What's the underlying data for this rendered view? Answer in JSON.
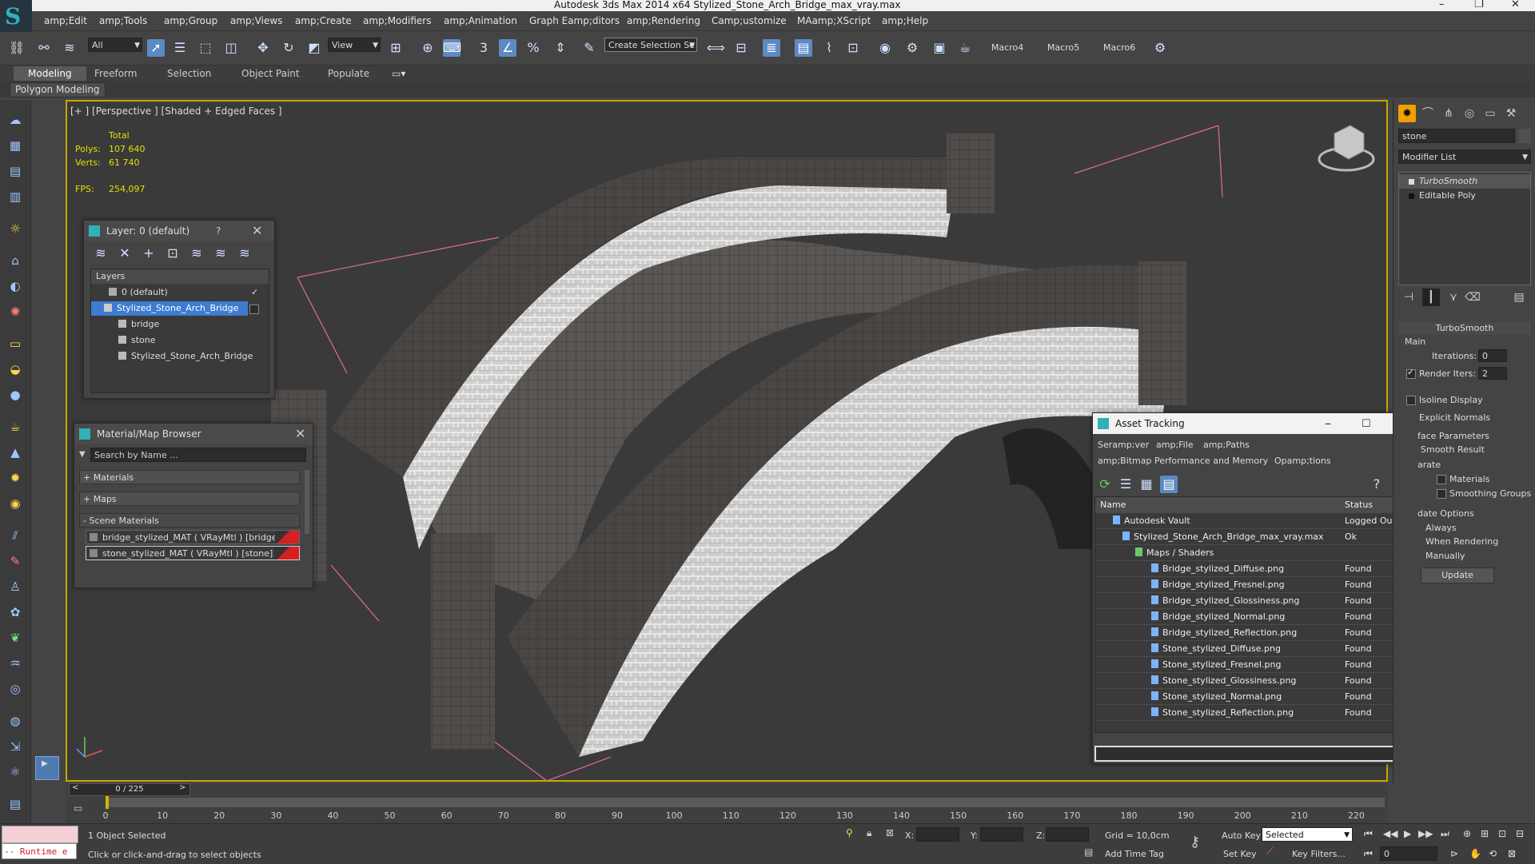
{
  "window": {
    "title": "Autodesk 3ds Max  2014 x64     Stylized_Stone_Arch_Bridge_max_vray.max",
    "min": "–",
    "max": "❐",
    "close": "✕"
  },
  "menu": [
    "amp;Edit",
    "amp;Tools",
    "amp;Group",
    "amp;Views",
    "amp;Create",
    "amp;Modifiers",
    "amp;Animation",
    "Graph Eamp;ditors",
    "amp;Rendering",
    "Camp;ustomize",
    "MAamp;XScript",
    "amp;Help"
  ],
  "toolbar": {
    "filter": "All",
    "refcoord": "View",
    "snap3": "3",
    "selection_set": "Create Selection Se",
    "macros": [
      "Macro4",
      "Macro5",
      "Macro6"
    ]
  },
  "ribbon": {
    "tabs": [
      "Modeling",
      "Freeform",
      "Selection",
      "Object Paint",
      "Populate"
    ],
    "active": "Modeling",
    "sub": "Polygon Modeling"
  },
  "viewport": {
    "label": "[+ ] [Perspective ] [Shaded + Edged Faces ]",
    "stats": {
      "total": "Total",
      "polys_label": "Polys:",
      "polys": "107 640",
      "verts_label": "Verts:",
      "verts": "61 740",
      "fps_label": "FPS:",
      "fps": "254,097"
    }
  },
  "layer_panel": {
    "title": "Layer: 0 (default)",
    "help": "?",
    "header": "Layers",
    "rows": [
      "0 (default)",
      "Stylized_Stone_Arch_Bridge",
      "bridge",
      "stone",
      "Stylized_Stone_Arch_Bridge"
    ]
  },
  "material_browser": {
    "title": "Material/Map Browser",
    "search": "Search by Name ...",
    "sections": [
      "+ Materials",
      "+ Maps",
      "- Scene Materials"
    ],
    "materials": [
      "bridge_stylized_MAT ( VRayMtl ) [bridge]",
      "stone_stylized_MAT ( VRayMtl ) [stone]"
    ]
  },
  "asset_tracking": {
    "title": "Asset Tracking",
    "menu1": [
      "Seramp;ver",
      "amp;File",
      "amp;Paths"
    ],
    "menu2": [
      "amp;Bitmap Performance and Memory",
      "Opamp;tions"
    ],
    "col_name": "Name",
    "col_status": "Status",
    "rows": [
      {
        "name": "Autodesk Vault",
        "status": "Logged Out ..."
      },
      {
        "name": "Stylized_Stone_Arch_Bridge_max_vray.max",
        "status": "Ok"
      },
      {
        "name": "Maps / Shaders",
        "status": ""
      },
      {
        "name": "Bridge_stylized_Diffuse.png",
        "status": "Found"
      },
      {
        "name": "Bridge_stylized_Fresnel.png",
        "status": "Found"
      },
      {
        "name": "Bridge_stylized_Glossiness.png",
        "status": "Found"
      },
      {
        "name": "Bridge_stylized_Normal.png",
        "status": "Found"
      },
      {
        "name": "Bridge_stylized_Reflection.png",
        "status": "Found"
      },
      {
        "name": "Stone_stylized_Diffuse.png",
        "status": "Found"
      },
      {
        "name": "Stone_stylized_Fresnel.png",
        "status": "Found"
      },
      {
        "name": "Stone_stylized_Glossiness.png",
        "status": "Found"
      },
      {
        "name": "Stone_stylized_Normal.png",
        "status": "Found"
      },
      {
        "name": "Stone_stylized_Reflection.png",
        "status": "Found"
      }
    ]
  },
  "command_panel": {
    "object_name": "stone",
    "modifier_list": "Modifier List",
    "stack": [
      "TurboSmooth",
      "Editable Poly"
    ],
    "rollout": "TurboSmooth",
    "main": "Main",
    "iterations_label": "Iterations:",
    "iterations": "0",
    "render_iters_label": "Render Iters:",
    "render_iters": "2",
    "isoline": "Isoline Display",
    "explicit": "Explicit Normals",
    "surface": "face Parameters",
    "smooth_result": "Smooth Result",
    "separate": "arate",
    "materials": "Materials",
    "smoothing_groups": "Smoothing Groups",
    "update_options": "date Options",
    "always": "Always",
    "when_rendering": "When Rendering",
    "manually": "Manually",
    "update_btn": "Update"
  },
  "timeline": {
    "frame": "0 / 225",
    "ticks": [
      0,
      10,
      20,
      30,
      40,
      50,
      60,
      70,
      80,
      90,
      100,
      110,
      120,
      130,
      140,
      150,
      160,
      170,
      180,
      190,
      200,
      210,
      220
    ]
  },
  "status": {
    "maxscript": "-- Runtime e",
    "selected": "1 Object Selected",
    "prompt": "Click or click-and-drag to select objects",
    "x": "X:",
    "y": "Y:",
    "z": "Z:",
    "grid": "Grid = 10,0cm",
    "add_time_tag": "Add Time Tag",
    "auto_key": "Auto Key",
    "set_key": "Set Key",
    "key_mode": "Selected",
    "key_filters": "Key Filters...",
    "frame_field": "0"
  },
  "colors": {
    "accent": "#5c8ac2",
    "viewport_border": "#c9a800",
    "stats": "#e4e000",
    "selection": "#3d7cd1"
  }
}
